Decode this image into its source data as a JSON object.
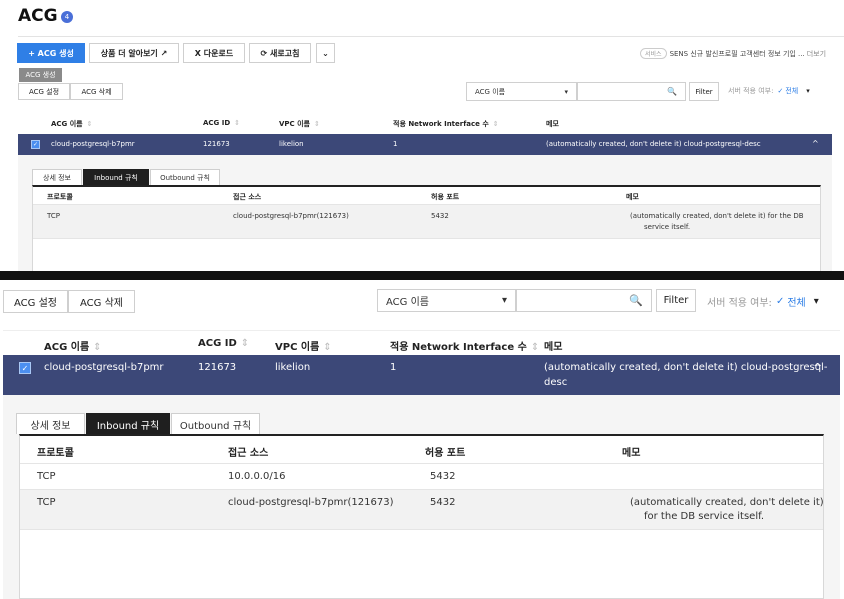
{
  "page": {
    "title": "ACG",
    "info_badge": "4"
  },
  "toolbar": {
    "create_label": "+ ACG 생성",
    "learn_more_label": "상품 더 알아보기 ↗",
    "download_label": "X 다운로드",
    "refresh_label": "⟳ 새로고침",
    "more_label": "⌄",
    "tooltip": "ACG 생성",
    "settings_label": "ACG 설정",
    "delete_label": "ACG 삭제"
  },
  "notice": {
    "badge": "서비스",
    "text": "SENS 신규 발신프로필 고객센터 정보 기입 ...",
    "more": "더보기"
  },
  "filter": {
    "select_value": "ACG 이름",
    "select_caret": "▾",
    "search_placeholder": "",
    "search_icon": "🔍",
    "filter_label": "Filter",
    "status_label": "서버 적용 여부:",
    "status_check": "✓",
    "status_value": "전체",
    "status_caret": "▾"
  },
  "table": {
    "columns": [
      "ACG 이름",
      "ACG ID",
      "VPC 이름",
      "적용 Network Interface 수",
      "메모"
    ],
    "sort_glyph": "⇕",
    "selected_row": {
      "checkbox": "✓",
      "name": "cloud-postgresql-b7pmr",
      "id": "121673",
      "vpc": "likelion",
      "nic_count": "1",
      "memo": "(automatically created, don't delete it) cloud-postgresql-desc",
      "memo_line1": "(automatically created, don't delete it) cloud-postgresql-",
      "memo_line2": "desc",
      "collapse": "^"
    }
  },
  "detail": {
    "tabs": [
      "상세 정보",
      "Inbound 규칙",
      "Outbound 규칙"
    ],
    "active_tab": "Inbound 규칙",
    "rule_columns": [
      "프로토콜",
      "접근 소스",
      "허용 포트",
      "메모"
    ],
    "rules_top": [
      {
        "protocol": "TCP",
        "source": "cloud-postgresql-b7pmr(121673)",
        "port": "5432",
        "memo_line1": "(automatically created, don't delete it) for the DB",
        "memo_line2": "service itself."
      }
    ],
    "rules_bottom": [
      {
        "protocol": "TCP",
        "source": "10.0.0.0/16",
        "port": "5432",
        "memo_line1": "",
        "memo_line2": ""
      },
      {
        "protocol": "TCP",
        "source": "cloud-postgresql-b7pmr(121673)",
        "port": "5432",
        "memo_line1": "(automatically created, don't delete it)",
        "memo_line2": "for the DB service itself."
      }
    ]
  },
  "colors": {
    "primary": "#2f7fe6",
    "selected_row": "#3c4878",
    "tab_active": "#1f1f1f"
  }
}
